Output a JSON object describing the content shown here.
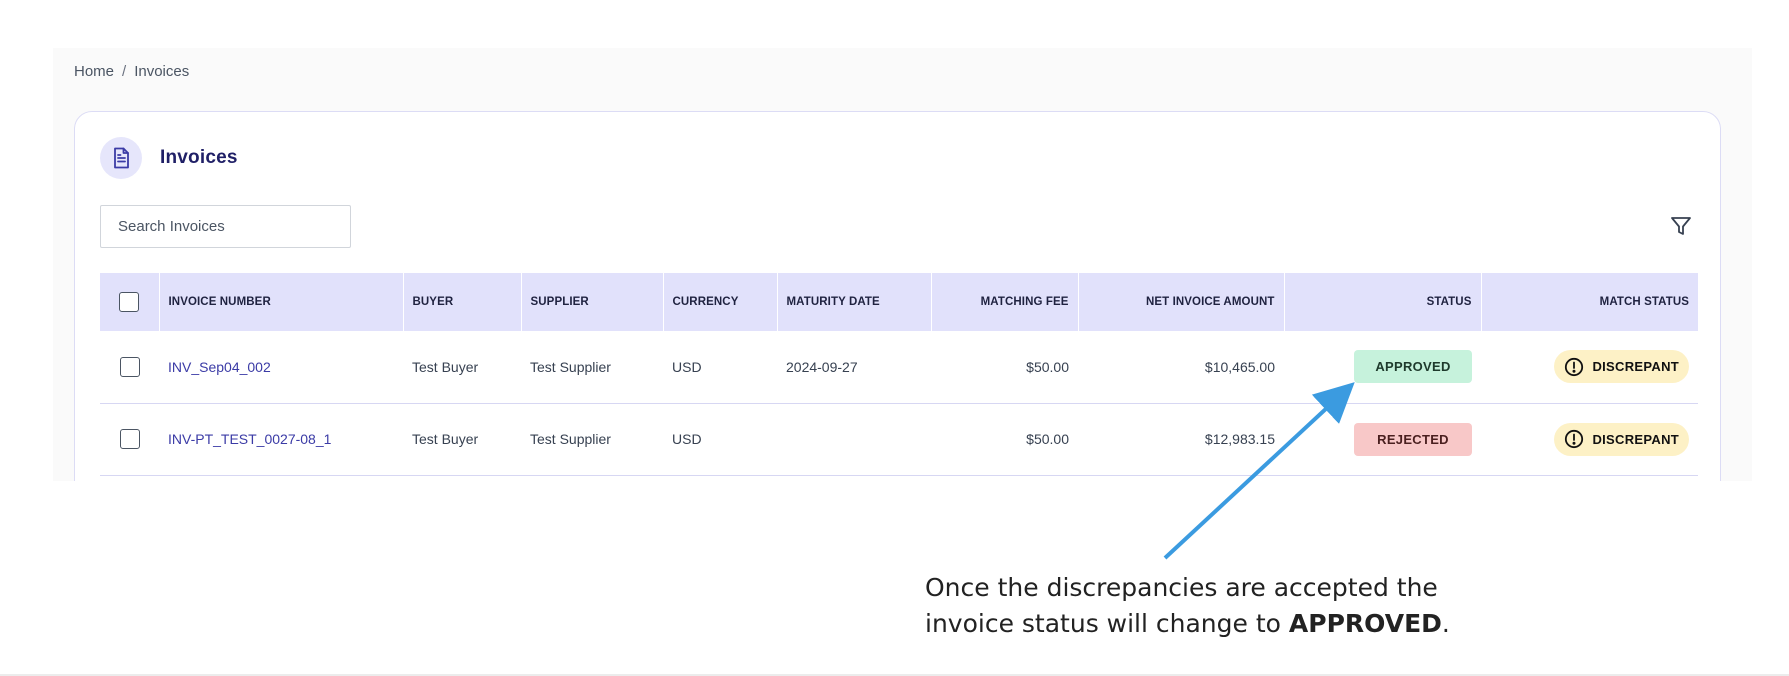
{
  "breadcrumb": {
    "home": "Home",
    "separator": "/",
    "current": "Invoices"
  },
  "card": {
    "title": "Invoices",
    "icon": "document-icon"
  },
  "search": {
    "placeholder": "Search Invoices",
    "value": ""
  },
  "filter": {
    "icon": "filter-icon"
  },
  "table": {
    "columns": [
      "INVOICE NUMBER",
      "BUYER",
      "SUPPLIER",
      "CURRENCY",
      "MATURITY DATE",
      "MATCHING FEE",
      "NET INVOICE AMOUNT",
      "STATUS",
      "MATCH STATUS"
    ],
    "rows": [
      {
        "invoice_number": "INV_Sep04_002",
        "buyer": "Test Buyer",
        "supplier": "Test Supplier",
        "currency": "USD",
        "maturity_date": "2024-09-27",
        "matching_fee": "$50.00",
        "net_invoice_amount": "$10,465.00",
        "status": "APPROVED",
        "match_status": "DISCREPANT"
      },
      {
        "invoice_number": "INV-PT_TEST_0027-08_1",
        "buyer": "Test Buyer",
        "supplier": "Test Supplier",
        "currency": "USD",
        "maturity_date": "",
        "matching_fee": "$50.00",
        "net_invoice_amount": "$12,983.15",
        "status": "REJECTED",
        "match_status": "DISCREPANT"
      }
    ]
  },
  "colors": {
    "accent": "#3b3ba6",
    "header_bg": "#e1e1fb",
    "approved_bg": "#c6f2dc",
    "approved_text": "#1e3a2c",
    "rejected_bg": "#f8c8c8",
    "rejected_text": "#4a1f1f",
    "discrepant_bg": "#fdf1c6",
    "arrow": "#3b9be0"
  },
  "annotation": {
    "line1": "Once the discrepancies are accepted the",
    "line2_prefix": "invoice status will change to",
    "line2_bold": "APPROVED",
    "line2_suffix": "."
  }
}
